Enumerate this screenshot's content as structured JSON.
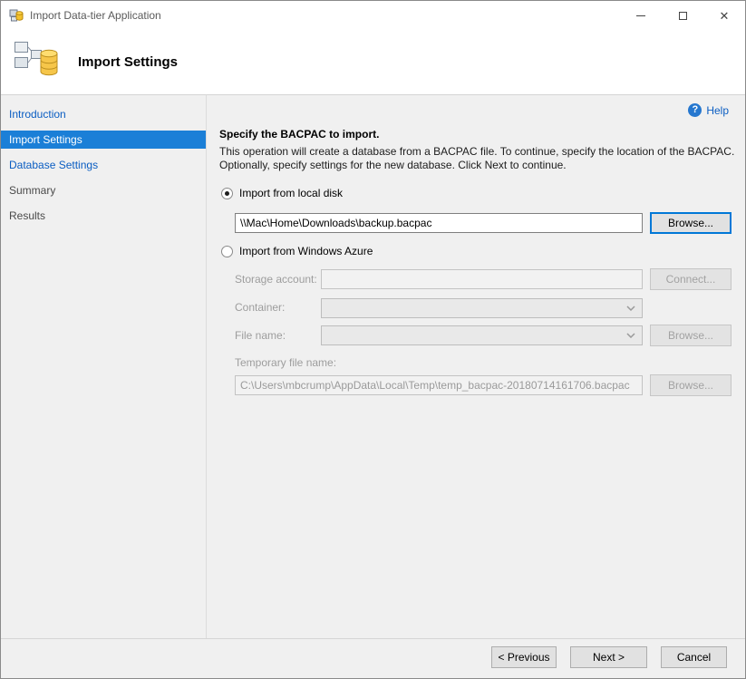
{
  "window": {
    "title": "Import Data-tier Application"
  },
  "icons": {
    "close_glyph": "✕",
    "help_glyph": "?"
  },
  "header": {
    "title": "Import Settings"
  },
  "sidebar": {
    "items": [
      {
        "label": "Introduction",
        "state": "link"
      },
      {
        "label": "Import Settings",
        "state": "selected"
      },
      {
        "label": "Database Settings",
        "state": "link"
      },
      {
        "label": "Summary",
        "state": "normal"
      },
      {
        "label": "Results",
        "state": "normal"
      }
    ]
  },
  "content": {
    "help_label": "Help",
    "heading": "Specify the BACPAC to import.",
    "description": "This operation will create a database from a BACPAC file. To continue, specify the location of the BACPAC. Optionally, specify settings for the new database. Click Next to continue.",
    "local_disk": {
      "radio_label": "Import from local disk",
      "radio_selected": true,
      "path_value": "\\\\Mac\\Home\\Downloads\\backup.bacpac",
      "browse_label": "Browse..."
    },
    "azure": {
      "radio_label": "Import from Windows Azure",
      "radio_selected": false,
      "storage_account_label": "Storage account:",
      "connect_label": "Connect...",
      "container_label": "Container:",
      "file_name_label": "File name:",
      "browse_label": "Browse...",
      "temp_file_label": "Temporary file name:",
      "temp_file_value": "C:\\Users\\mbcrump\\AppData\\Local\\Temp\\temp_bacpac-20180714161706.bacpac"
    }
  },
  "footer": {
    "previous_label": "< Previous",
    "next_label": "Next >",
    "cancel_label": "Cancel"
  },
  "colors": {
    "accent_blue": "#1b7fd7",
    "link_blue": "#0a5dc2",
    "focus_border": "#0078d7",
    "panel_gray": "#f0f0f0"
  }
}
